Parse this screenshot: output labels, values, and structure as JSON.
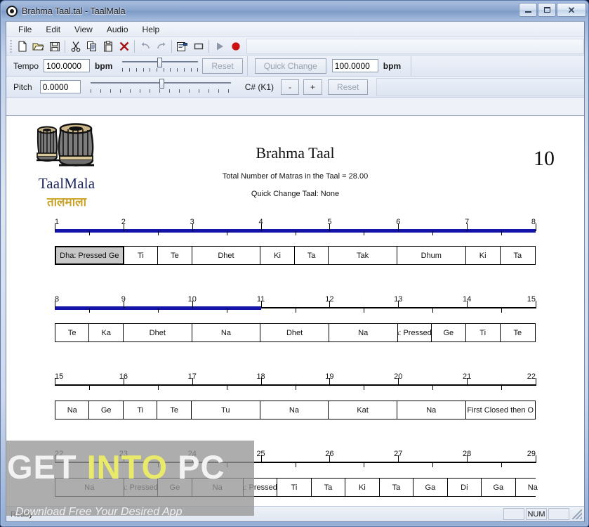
{
  "window": {
    "title": "Brahma Taal.tal - TaalMala",
    "icon": "record-circle-icon",
    "buttons": {
      "minimize": "minimize-icon",
      "maximize": "maximize-icon",
      "close": "close-icon"
    }
  },
  "menu": {
    "items": [
      {
        "label": "File"
      },
      {
        "label": "Edit"
      },
      {
        "label": "View"
      },
      {
        "label": "Audio"
      },
      {
        "label": "Help"
      }
    ]
  },
  "toolbar": {
    "buttons": [
      {
        "name": "new-icon"
      },
      {
        "name": "open-icon"
      },
      {
        "name": "save-icon"
      },
      {
        "name": "cut-icon"
      },
      {
        "name": "copy-icon"
      },
      {
        "name": "paste-icon"
      },
      {
        "name": "delete-icon"
      },
      {
        "name": "undo-icon"
      },
      {
        "name": "redo-icon"
      },
      {
        "name": "properties-icon"
      },
      {
        "name": "stop-icon"
      },
      {
        "name": "play-icon"
      },
      {
        "name": "record-icon"
      }
    ]
  },
  "tempo_bar": {
    "label": "Tempo",
    "value": "100.0000",
    "unit": "bpm",
    "reset_label": "Reset",
    "quick_change_label": "Quick Change",
    "quick_value": "100.0000",
    "quick_unit": "bpm"
  },
  "pitch_bar": {
    "label": "Pitch",
    "value": "0.0000",
    "note": "C# (K1)",
    "minus_label": "-",
    "plus_label": "+",
    "reset_label": "Reset"
  },
  "document": {
    "logo_name": "TaalMala",
    "logo_devanagari": "तालमाला",
    "title": "Brahma Taal",
    "subtitle_1": "Total Number of Matras in the Taal = 28.00",
    "subtitle_2": "Quick Change Taal: None",
    "big_number": "10"
  },
  "chart_data": {
    "type": "table",
    "title": "Brahma Taal",
    "rows": [
      {
        "ruler_ticks": [
          "1",
          "2",
          "3",
          "4",
          "5",
          "6",
          "7",
          "8"
        ],
        "progress_fraction": 1.0,
        "cells": [
          {
            "label": "Dha: Pressed Ge",
            "width": 14.3,
            "selected": true
          },
          {
            "label": "Ti",
            "width": 7.1,
            "selected": false
          },
          {
            "label": "Te",
            "width": 7.1,
            "selected": false
          },
          {
            "label": "Dhet",
            "width": 14.3,
            "selected": false
          },
          {
            "label": "Ki",
            "width": 7.1,
            "selected": false
          },
          {
            "label": "Ta",
            "width": 7.1,
            "selected": false
          },
          {
            "label": "Tak",
            "width": 14.3,
            "selected": false
          },
          {
            "label": "Dhum",
            "width": 14.3,
            "selected": false
          },
          {
            "label": "Ki",
            "width": 7.2,
            "selected": false
          },
          {
            "label": "Ta",
            "width": 7.2,
            "selected": false
          }
        ]
      },
      {
        "ruler_ticks": [
          "8",
          "9",
          "10",
          "11",
          "12",
          "13",
          "14",
          "15"
        ],
        "progress_fraction": 0.4285,
        "cells": [
          {
            "label": "Te",
            "width": 7.1,
            "selected": false
          },
          {
            "label": "Ka",
            "width": 7.1,
            "selected": false
          },
          {
            "label": "Dhet",
            "width": 14.3,
            "selected": false
          },
          {
            "label": "Na",
            "width": 14.3,
            "selected": false
          },
          {
            "label": "Dhet",
            "width": 14.3,
            "selected": false
          },
          {
            "label": "Na",
            "width": 14.3,
            "selected": false
          },
          {
            "label": "Dha: Pressed Ge",
            "width": 7.1,
            "selected": false
          },
          {
            "label": "Ge",
            "width": 7.1,
            "selected": false
          },
          {
            "label": "Ti",
            "width": 7.2,
            "selected": false
          },
          {
            "label": "Te",
            "width": 7.2,
            "selected": false
          }
        ]
      },
      {
        "ruler_ticks": [
          "15",
          "16",
          "17",
          "18",
          "19",
          "20",
          "21",
          "22"
        ],
        "progress_fraction": 0.0,
        "cells": [
          {
            "label": "Na",
            "width": 7.1,
            "selected": false
          },
          {
            "label": "Ge",
            "width": 7.1,
            "selected": false
          },
          {
            "label": "Ti",
            "width": 7.1,
            "selected": false
          },
          {
            "label": "Te",
            "width": 7.1,
            "selected": false
          },
          {
            "label": "Tu",
            "width": 14.3,
            "selected": false
          },
          {
            "label": "Na",
            "width": 14.3,
            "selected": false
          },
          {
            "label": "Kat",
            "width": 14.3,
            "selected": false
          },
          {
            "label": "Na",
            "width": 14.3,
            "selected": false
          },
          {
            "label": "First Closed then O",
            "width": 14.4,
            "selected": false
          }
        ]
      },
      {
        "ruler_ticks": [
          "22",
          "23",
          "24",
          "25",
          "26",
          "27",
          "28",
          "29"
        ],
        "progress_fraction": 0.0,
        "cells": [
          {
            "label": "Na",
            "width": 14.3,
            "selected": false
          },
          {
            "label": "Dha: Pressed Ge",
            "width": 7.1,
            "selected": false
          },
          {
            "label": "Ge",
            "width": 7.1,
            "selected": false
          },
          {
            "label": "Na",
            "width": 10.7,
            "selected": false
          },
          {
            "label": "Dha: Pressed Ge",
            "width": 7.1,
            "selected": false
          },
          {
            "label": "Ti",
            "width": 7.1,
            "selected": false
          },
          {
            "label": "Ta",
            "width": 7.1,
            "selected": false
          },
          {
            "label": "Ki",
            "width": 7.1,
            "selected": false
          },
          {
            "label": "Ta",
            "width": 7.1,
            "selected": false
          },
          {
            "label": "Ga",
            "width": 7.1,
            "selected": false
          },
          {
            "label": "Di",
            "width": 7.1,
            "selected": false
          },
          {
            "label": "Ga",
            "width": 7.1,
            "selected": false
          },
          {
            "label": "Na",
            "width": 7.1,
            "selected": false
          }
        ]
      }
    ]
  },
  "watermark": {
    "part1": "GET ",
    "part2": "INTO ",
    "part3": "PC",
    "subtitle": "Download Free Your Desired App"
  },
  "status_bar": {
    "text": "Ready",
    "pane_1": "",
    "pane_2": "NUM",
    "pane_3": ""
  },
  "colors": {
    "progress": "#1414a8",
    "selected_cell": "#c8c8c8",
    "logo_name": "#1c2559",
    "logo_devanagari": "#c9a227",
    "record": "#cc1111"
  }
}
